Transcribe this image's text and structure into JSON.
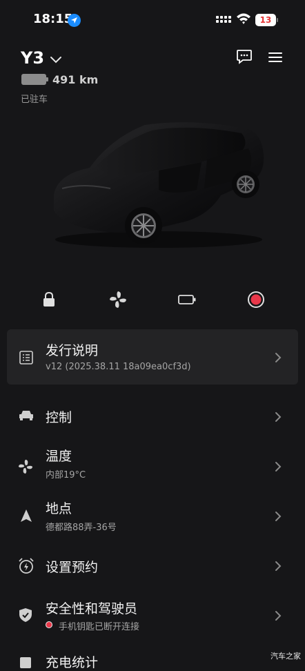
{
  "status_bar": {
    "time": "18:15",
    "battery": "13"
  },
  "header": {
    "car_name": "Y3",
    "range": "491 km",
    "state": "已驻车"
  },
  "quick_actions": [
    "lock-icon",
    "fan-icon",
    "battery-icon",
    "record-icon"
  ],
  "release_notes": {
    "title": "发行说明",
    "subtitle": "v12 (2025.38.11 18a09ea0cf3d)"
  },
  "menu": [
    {
      "title": "控制",
      "subtitle": ""
    },
    {
      "title": "温度",
      "subtitle": "内部19°C"
    },
    {
      "title": "地点",
      "subtitle": "德都路88弄-36号"
    },
    {
      "title": "设置预约",
      "subtitle": ""
    },
    {
      "title": "安全性和驾驶员",
      "subtitle": "手机钥匙已断开连接"
    },
    {
      "title": "充电统计",
      "subtitle": ""
    }
  ],
  "colors": {
    "background": "#161618",
    "card": "#232325",
    "alert": "#e8384a",
    "location": "#1a8cff"
  },
  "watermark": "汽车之家"
}
